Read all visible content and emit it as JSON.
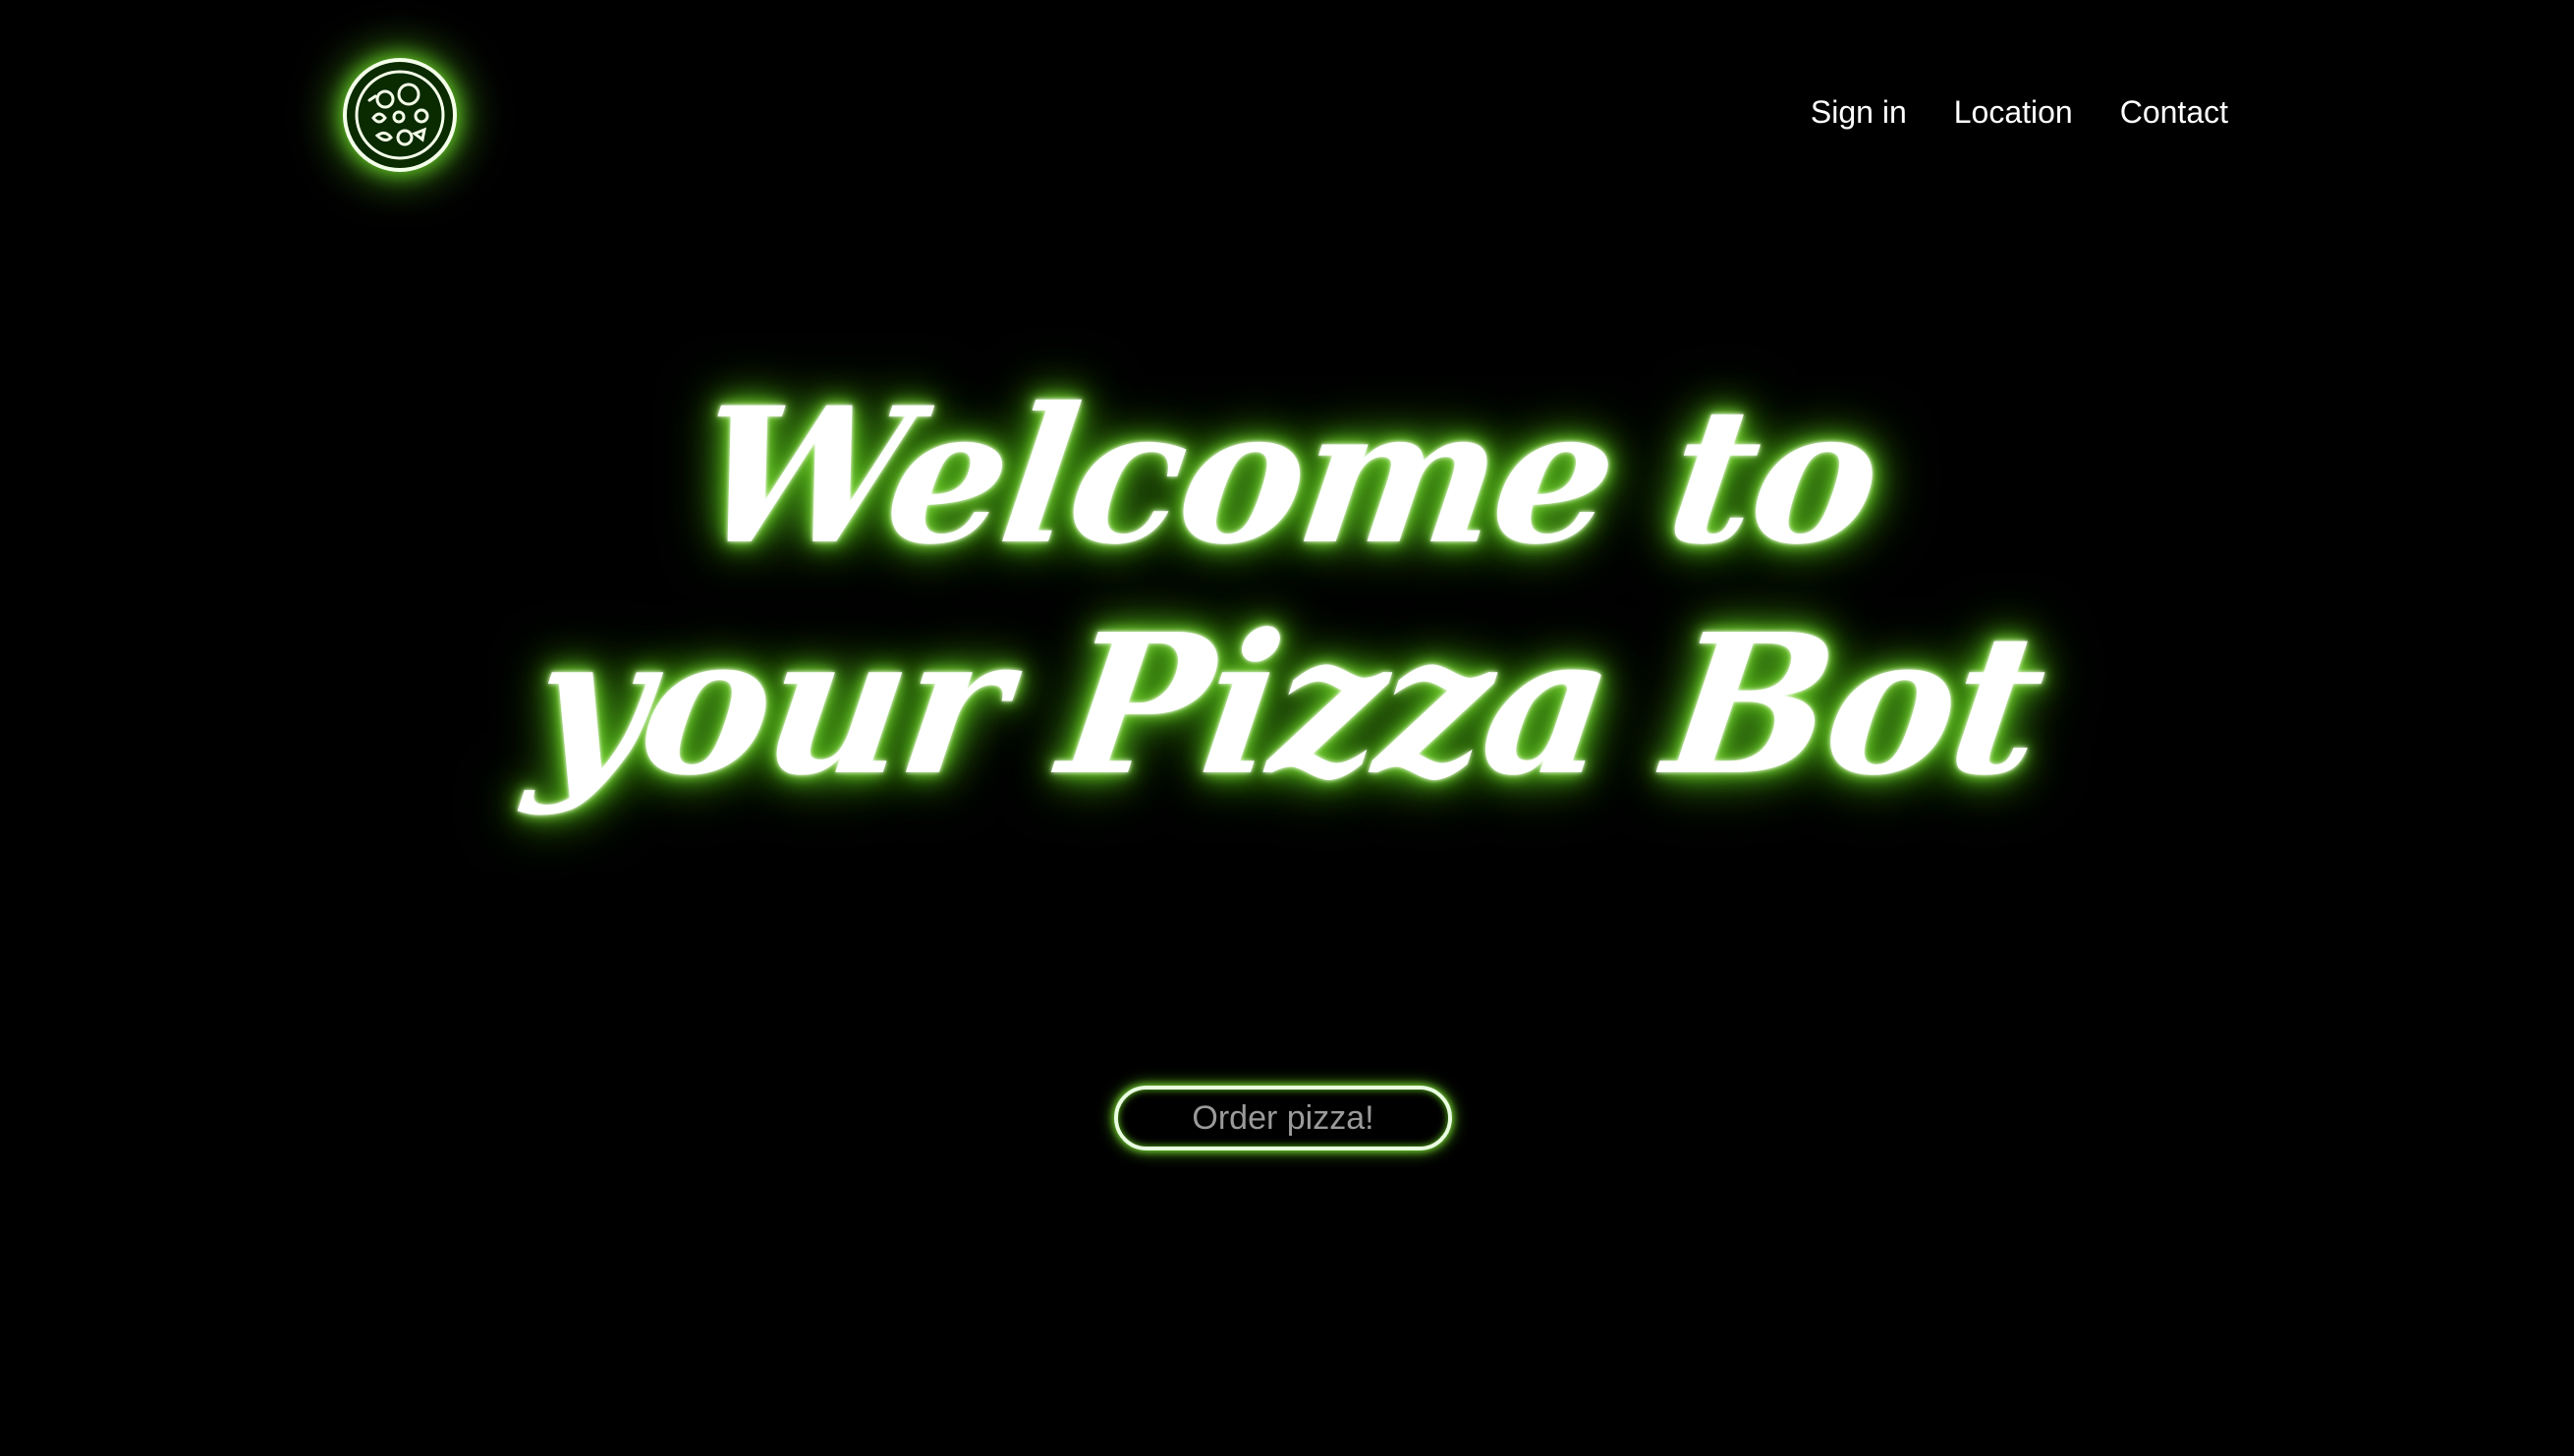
{
  "header": {
    "logo_icon": "pizza-icon",
    "nav": [
      {
        "label": "Sign in"
      },
      {
        "label": "Location"
      },
      {
        "label": "Contact"
      }
    ]
  },
  "hero": {
    "line1": "Welcome to",
    "line2": "your Pizza Bot"
  },
  "cta": {
    "label": "Order pizza!"
  },
  "colors": {
    "background": "#000000",
    "text": "#ffffff",
    "glow": "#5fc21c",
    "button_text": "#9a9a9a"
  }
}
